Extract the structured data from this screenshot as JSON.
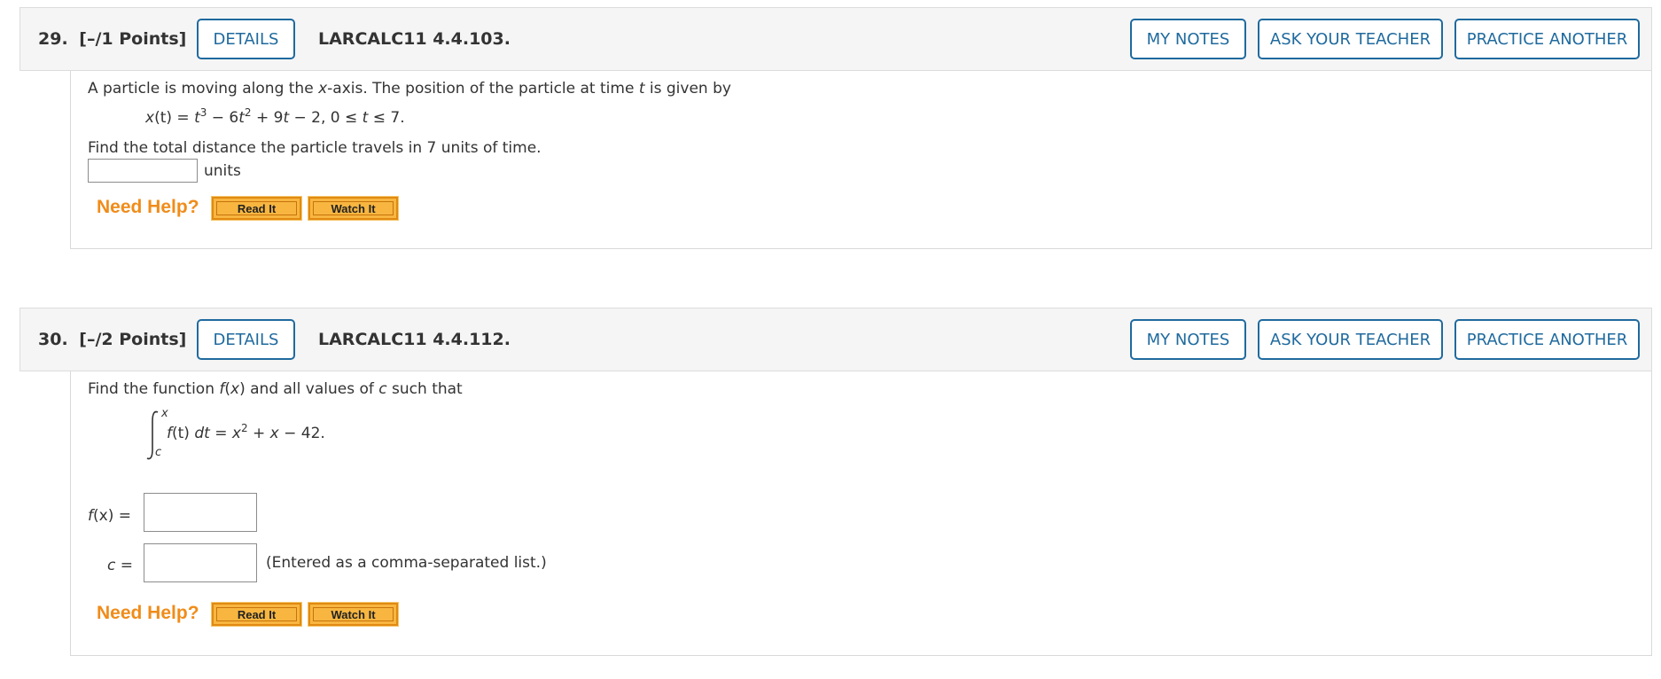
{
  "q29": {
    "number": "29.",
    "points": "[–/1 Points]",
    "details_label": "DETAILS",
    "code": "LARCALC11 4.4.103.",
    "my_notes_label": "MY NOTES",
    "ask_teacher_label": "ASK YOUR TEACHER",
    "practice_label": "PRACTICE ANOTHER",
    "prompt_a": "A particle is moving along the ",
    "prompt_var_x": "x",
    "prompt_b": "-axis. The position of the particle at time ",
    "prompt_var_t": "t",
    "prompt_c": " is given by",
    "eq_lhs": "x",
    "eq_paren": "(t)",
    "eq_eq": " = ",
    "eq_t1": "t",
    "eq_exp1": "3",
    "eq_minus": " − 6",
    "eq_t2": "t",
    "eq_exp2": "2",
    "eq_plus": " + 9",
    "eq_t3": "t",
    "eq_tail": " − 2,  0 ≤ ",
    "eq_t4": "t",
    "eq_end": " ≤ 7.",
    "find_text": "Find the total distance the particle travels in 7 units of time.",
    "answer_value": "",
    "units_label": "units",
    "need_help": "Need Help?",
    "read_it": "Read It",
    "watch_it": "Watch It"
  },
  "q30": {
    "number": "30.",
    "points": "[–/2 Points]",
    "details_label": "DETAILS",
    "code": "LARCALC11 4.4.112.",
    "my_notes_label": "MY NOTES",
    "ask_teacher_label": "ASK YOUR TEACHER",
    "practice_label": "PRACTICE ANOTHER",
    "prompt_a": "Find the function ",
    "prompt_f": "f",
    "prompt_b": "(",
    "prompt_x": "x",
    "prompt_c": ") and all values of ",
    "prompt_cvar": "c",
    "prompt_d": " such that",
    "int_upper": "x",
    "int_lower": "c",
    "int_f": "f",
    "int_body": "(t) ",
    "int_dt_d": "dt",
    "int_eq": " = ",
    "int_x": "x",
    "int_exp": "2",
    "int_tail": " + ",
    "int_x2": "x",
    "int_end": " − 42.",
    "fx_label_f": "f",
    "fx_label_rest": "(x)  =",
    "fx_value": "",
    "c_label_c": "c",
    "c_label_rest": " =",
    "c_value": "",
    "c_note": "(Entered as a comma-separated list.)",
    "need_help": "Need Help?",
    "read_it": "Read It",
    "watch_it": "Watch It"
  },
  "colors": {
    "accent_blue": "#1f6a9e",
    "need_help_orange": "#f08c1a",
    "help_button_fill": "#f8b640"
  }
}
